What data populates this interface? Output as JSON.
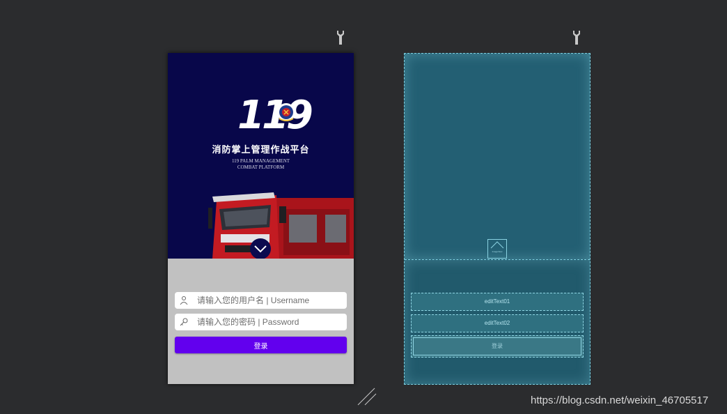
{
  "phone": {
    "logo_number": "119",
    "title": "消防掌上管理作战平台",
    "subtitle_line1": "119 PALM MANAGEMENT",
    "subtitle_line2": "COMBAT PLATFORM",
    "username_placeholder": "请输入您的用户名 | Username",
    "password_placeholder": "请输入您的密码 | Password",
    "login_label": "登录"
  },
  "blueprint": {
    "image_label": "ImageView",
    "edit_text_1": "editText01",
    "edit_text_2": "editText02",
    "button_label": "登录"
  },
  "watermark": "https://blog.csdn.net/weixin_46705517",
  "colors": {
    "workspace": "#2b2c2e",
    "banner": "#08074a",
    "form_background": "#c1c1c1",
    "button": "#6200ee",
    "blueprint": "#215a6c",
    "blueprint_outline": "#7fd0e0"
  },
  "icons": {
    "toolbar": "wrench-icon",
    "username": "user-icon",
    "password": "key-icon",
    "expand": "chevron-down-icon"
  }
}
